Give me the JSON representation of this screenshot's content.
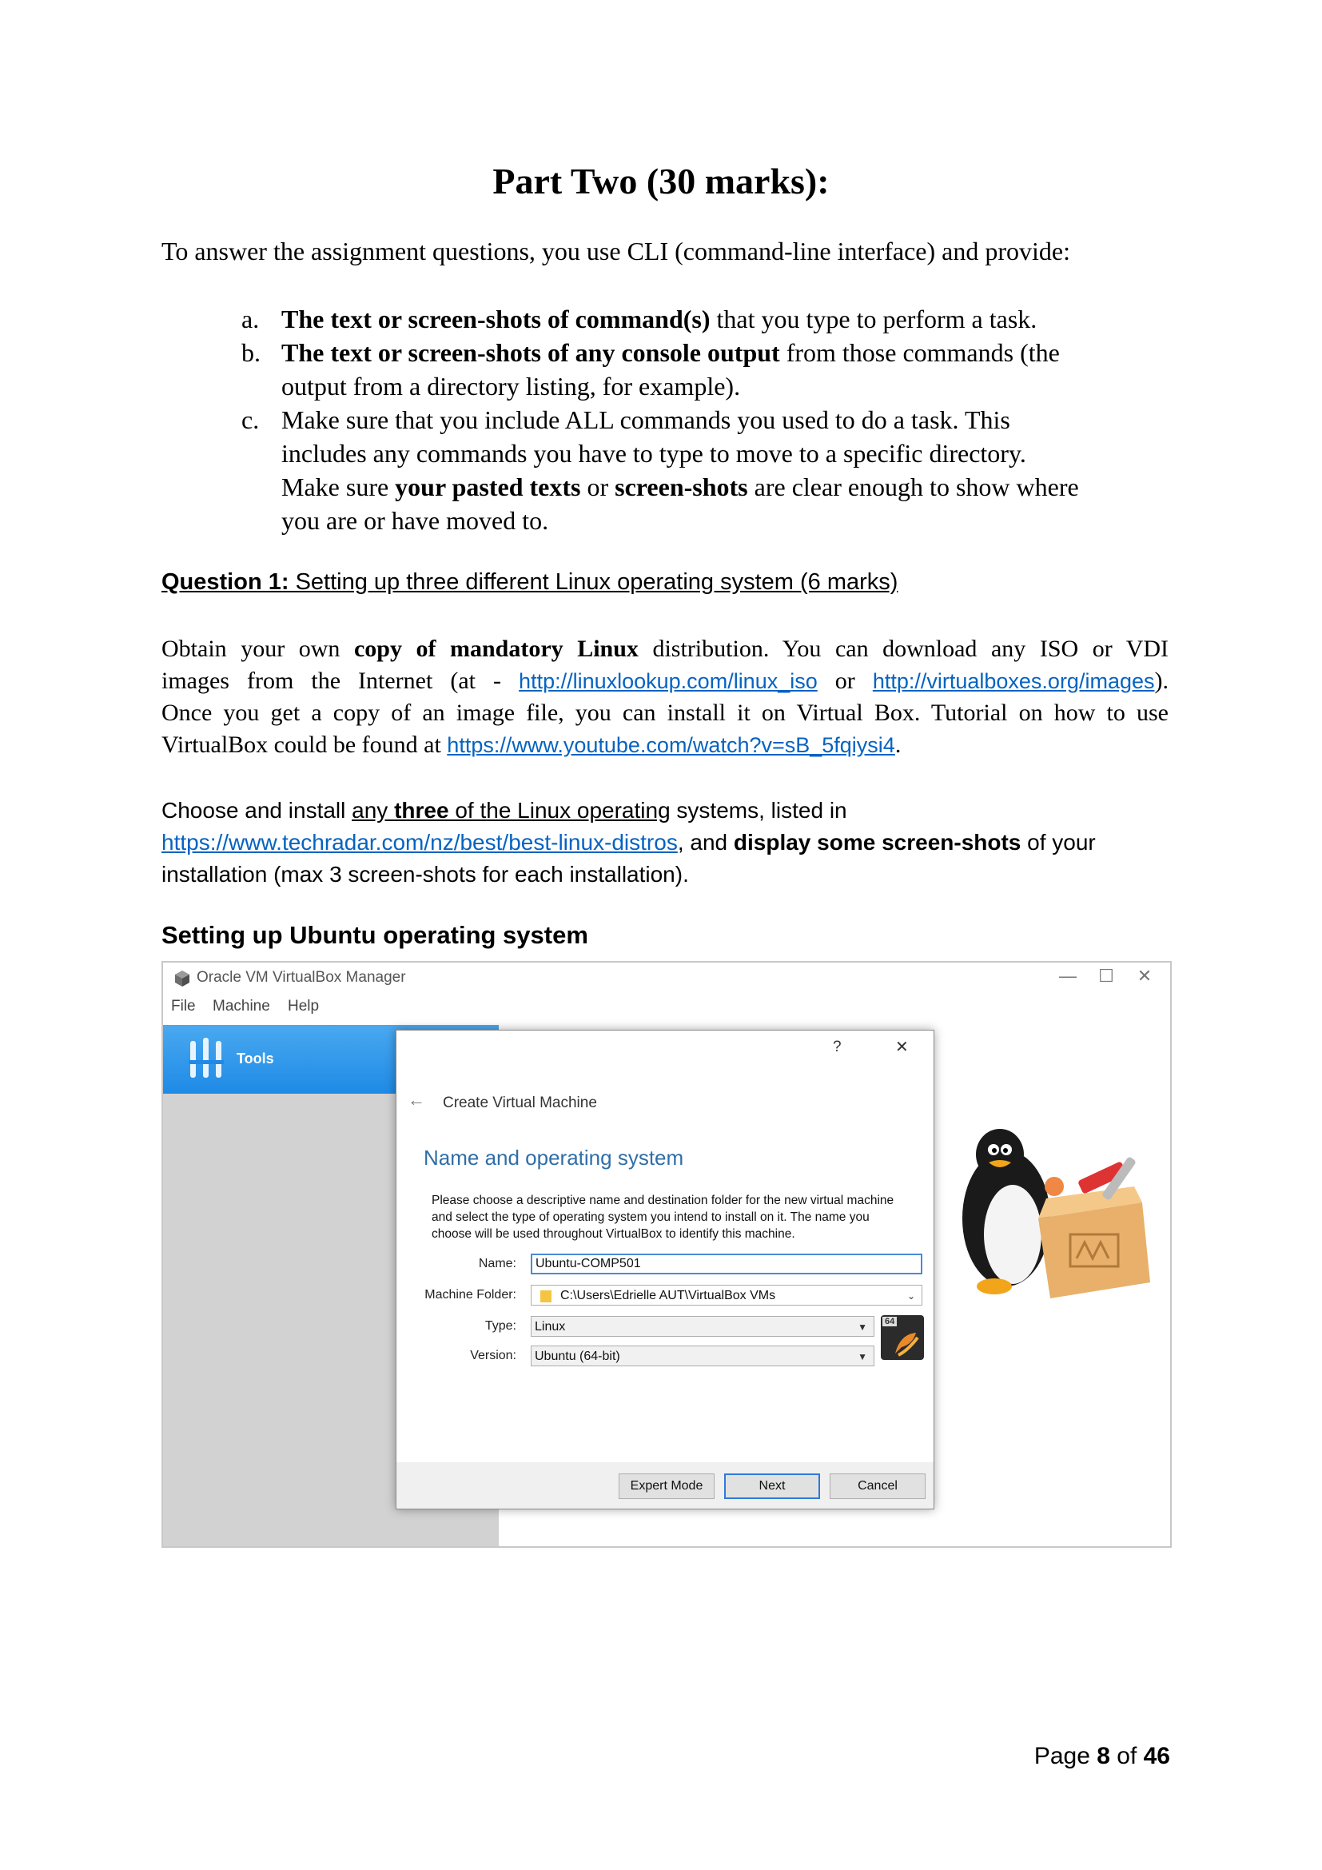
{
  "title": "Part Two (30 marks):",
  "intro": "To answer the assignment questions, you use CLI (command-line interface) and provide:",
  "items": [
    {
      "marker": "a.",
      "bold": "The text or screen-shots of command(s)",
      "rest": " that you type to perform a task."
    },
    {
      "marker": "b.",
      "bold": "The text or screen-shots of any console output",
      "rest1": " from those commands (the",
      "line2": "output from a directory listing, for example)."
    },
    {
      "marker": "c.",
      "line1": "Make sure that you include ALL commands you used to do a task. This",
      "line2": "includes any commands you have to type to move to a specific directory.",
      "line3_pre": "Make sure ",
      "line3_b1": "your pasted texts",
      "line3_mid": " or ",
      "line3_b2": "screen-shots",
      "line3_post": " are clear enough to show where",
      "line4": "you are or have moved to."
    }
  ],
  "question1": {
    "label": "Question 1:",
    "title": " Setting up three different Linux operating system (6 marks)"
  },
  "para1": {
    "l1_pre": "Obtain your own ",
    "l1_bold": "copy of mandatory Linux",
    "l1_post": " distribution. You can download any ISO or VDI",
    "l2_pre": "images from the Internet (at - ",
    "link1": "http://linuxlookup.com/linux_iso",
    "l2_mid": " or ",
    "link2": "http://virtualboxes.org/images",
    "l2_post": ").",
    "l3": "Once you get a copy of an image file, you can install it on Virtual Box. Tutorial on how to use",
    "l4_pre": "VirtualBox could be found at ",
    "link3": "https://www.youtube.com/watch?v=sB_5fqiysi4",
    "l4_post": "."
  },
  "para2": {
    "pre": "Choose and install ",
    "u1": "any ",
    "u_bold": "three",
    "u2": " of the Linux operating",
    "mid": " systems, listed in",
    "link": "https://www.techradar.com/nz/best/best-linux-distros",
    "after_link": ", and ",
    "bold": "display some screen-shots",
    "post": " of your",
    "line3": "installation (max 3 screen-shots for each installation)."
  },
  "ubuntu_heading": "Setting up Ubuntu operating system",
  "screenshot": {
    "window_title": "Oracle VM VirtualBox Manager",
    "menu": [
      "File",
      "Machine",
      "Help"
    ],
    "tools_label": "Tools",
    "dialog": {
      "help": "?",
      "close": "✕",
      "back": "←",
      "title": "Create Virtual Machine",
      "section": "Name and operating system",
      "description": "Please choose a descriptive name and destination folder for the new virtual machine and select the type of operating system you intend to install on it. The name you choose will be used throughout VirtualBox to identify this machine.",
      "fields": {
        "name_label": "Name:",
        "name_value": "Ubuntu-COMP501",
        "folder_label": "Machine Folder:",
        "folder_value": "C:\\Users\\Edrielle AUT\\VirtualBox VMs",
        "type_label": "Type:",
        "type_value": "Linux",
        "version_label": "Version:",
        "version_value": "Ubuntu (64-bit)"
      },
      "os_badge": "64",
      "buttons": {
        "expert": "Expert Mode",
        "next": "Next",
        "cancel": "Cancel"
      }
    },
    "window_buttons": {
      "minimize": "—",
      "maximize": "☐",
      "close": "✕"
    }
  },
  "footer": {
    "pre": "Page ",
    "page": "8",
    "mid": " of ",
    "total": "46"
  }
}
